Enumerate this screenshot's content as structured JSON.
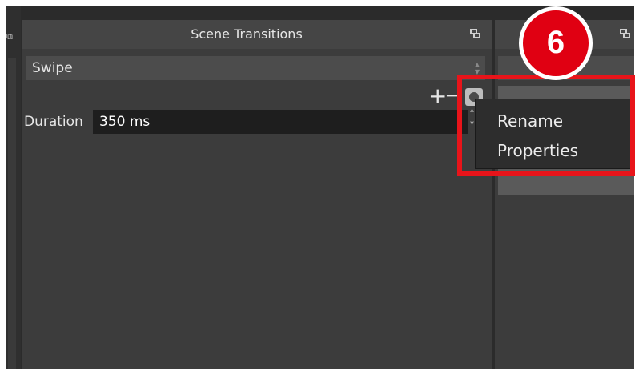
{
  "panel": {
    "title": "Scene Transitions",
    "transition_select": {
      "value": "Swipe"
    },
    "add_symbol": "+",
    "remove_symbol": "−",
    "duration": {
      "label": "Duration",
      "value": "350 ms"
    }
  },
  "context_menu": {
    "items": [
      {
        "label": "Rename"
      },
      {
        "label": "Properties"
      }
    ]
  },
  "annotation": {
    "step_number": "6",
    "badge_color": "#e00012",
    "highlight_color": "#e8141a"
  },
  "icons": {
    "panel_undock": "undock-icon",
    "transition_properties": "gear-icon"
  },
  "colors": {
    "background": "#2b2b2b",
    "panel": "#3c3c3c",
    "field": "#1e1e1e",
    "text": "#e6e6e6"
  }
}
